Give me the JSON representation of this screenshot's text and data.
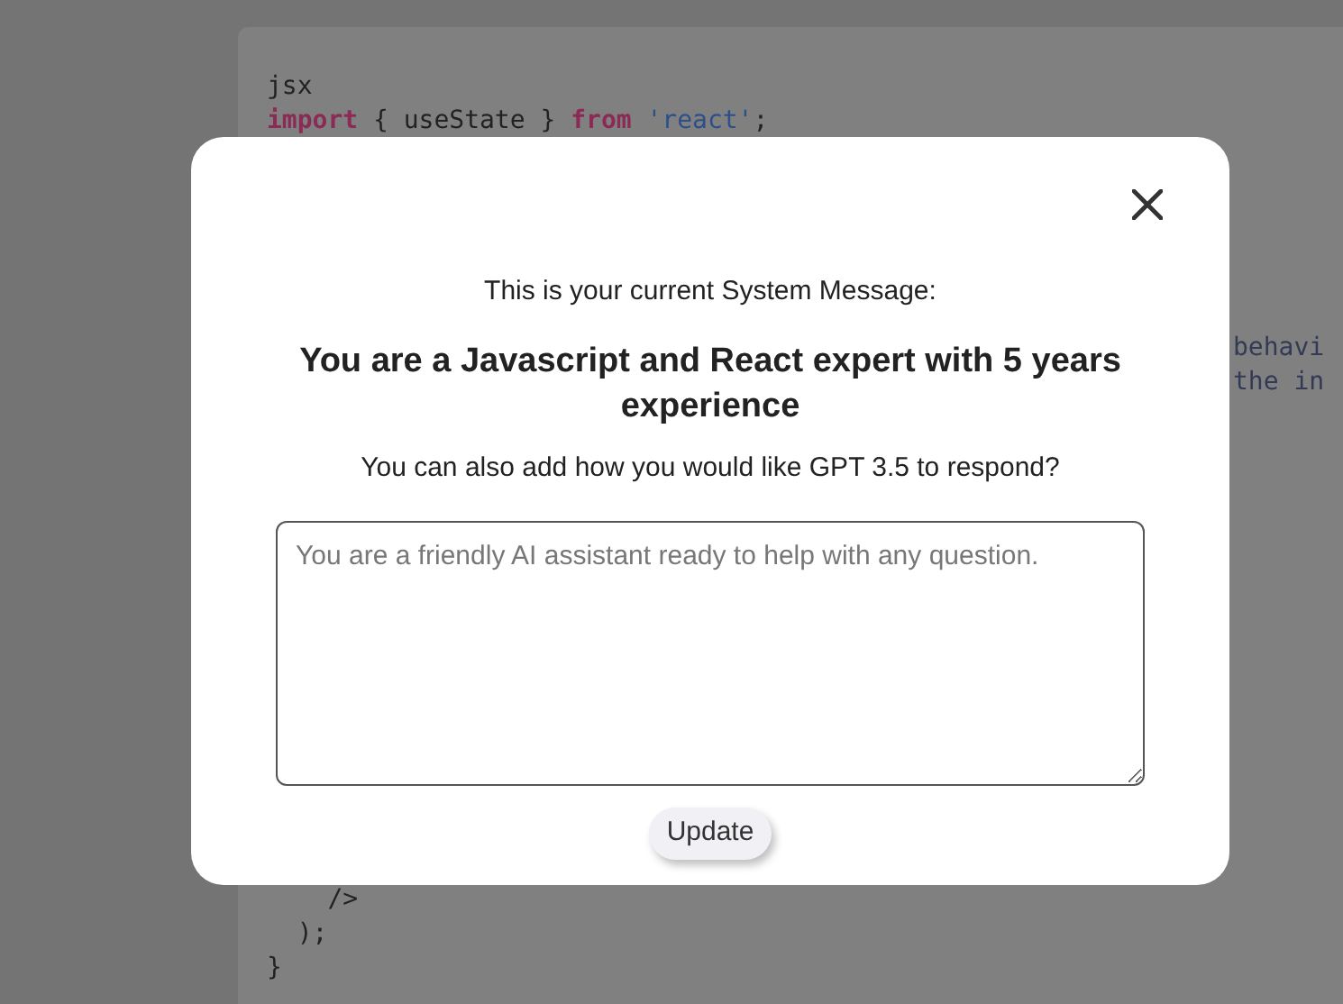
{
  "code": {
    "top_lines": [
      [
        {
          "kind": "plain",
          "text": "jsx"
        }
      ],
      [
        {
          "kind": "keyword",
          "text": "import"
        },
        {
          "kind": "plain",
          "text": " { useState } "
        },
        {
          "kind": "keyword",
          "text": "from"
        },
        {
          "kind": "string",
          "text": "'react'",
          "space_before": true
        },
        {
          "kind": "plain",
          "text": ";"
        }
      ]
    ],
    "side_lines": [
      "behavi",
      "the in"
    ],
    "bottom_lines": [
      "    />",
      "  );",
      "}"
    ]
  },
  "modal": {
    "intro": "This is your current System Message:",
    "system_message": "You are a Javascript and React expert with 5 years experience",
    "prompt": "You can also add how you would like GPT 3.5 to respond?",
    "input": {
      "placeholder": "You are a friendly AI assistant ready to help with any question."
    },
    "button": "Update"
  }
}
